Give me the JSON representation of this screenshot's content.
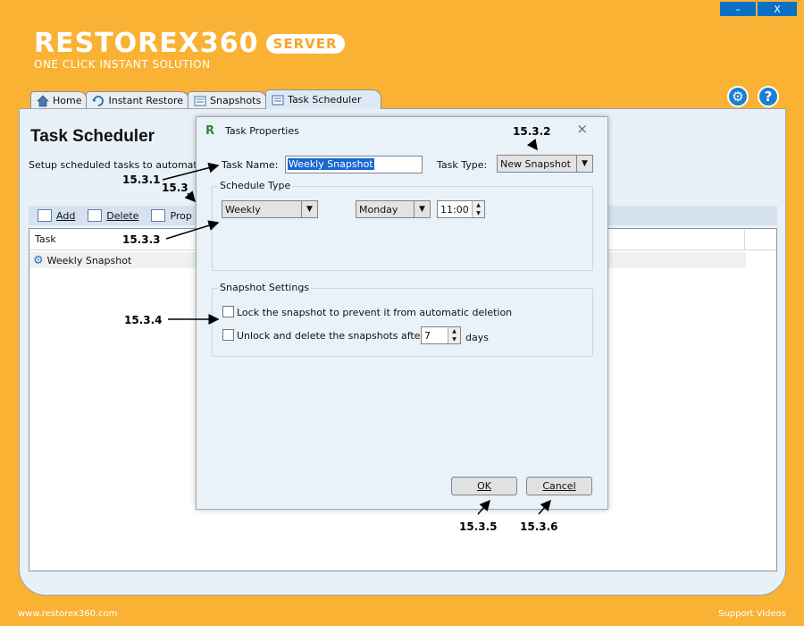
{
  "window": {
    "minimize": "–",
    "close": "X"
  },
  "logo": {
    "name": "RESTOREX360",
    "badge": "SERVER",
    "tagline": "ONE CLICK INSTANT SOLUTION"
  },
  "tabs": [
    {
      "label": "Home",
      "icon": "home-icon"
    },
    {
      "label": "Instant Restore",
      "icon": "restore-icon"
    },
    {
      "label": "Snapshots",
      "icon": "snapshots-icon"
    },
    {
      "label": "Task Scheduler",
      "icon": "scheduler-icon"
    }
  ],
  "top_icons": {
    "settings": "⚙",
    "help": "?"
  },
  "page": {
    "title": "Task Scheduler",
    "description": "Setup scheduled tasks to automatically"
  },
  "toolbar": {
    "add": "Add",
    "delete": "Delete",
    "properties": "Prop"
  },
  "task_list": {
    "column": "Task",
    "rows": [
      {
        "name": "Weekly Snapshot"
      }
    ]
  },
  "dialog": {
    "title": "Task Properties",
    "close": "×",
    "task_name_label": "Task Name:",
    "task_name_value": "Weekly Snapshot",
    "task_type_label": "Task Type:",
    "task_type_value": "New Snapshot",
    "schedule_group": "Schedule Type",
    "schedule_value": "Weekly",
    "day_value": "Monday",
    "time_value": "11:00",
    "snapshot_group": "Snapshot Settings",
    "lock_label": "Lock the snapshot to prevent it from automatic deletion",
    "lock_checked": false,
    "unlock_label": "Unlock and delete the snapshots after",
    "unlock_checked": false,
    "days_value": "7",
    "days_label": "days",
    "ok": "OK",
    "cancel": "Cancel"
  },
  "annotations": {
    "a1": "15.3.1",
    "a2": "15.3.2",
    "a3": "15.3",
    "a4": "15.3.3",
    "a5": "15.3.4",
    "a6": "15.3.5",
    "a7": "15.3.6"
  },
  "footer": {
    "website": "www.restorex360.com",
    "support": "Support Videos"
  },
  "colors": {
    "background": "#f9b233",
    "accent": "#1d7fd1",
    "selection": "#1967d2"
  }
}
